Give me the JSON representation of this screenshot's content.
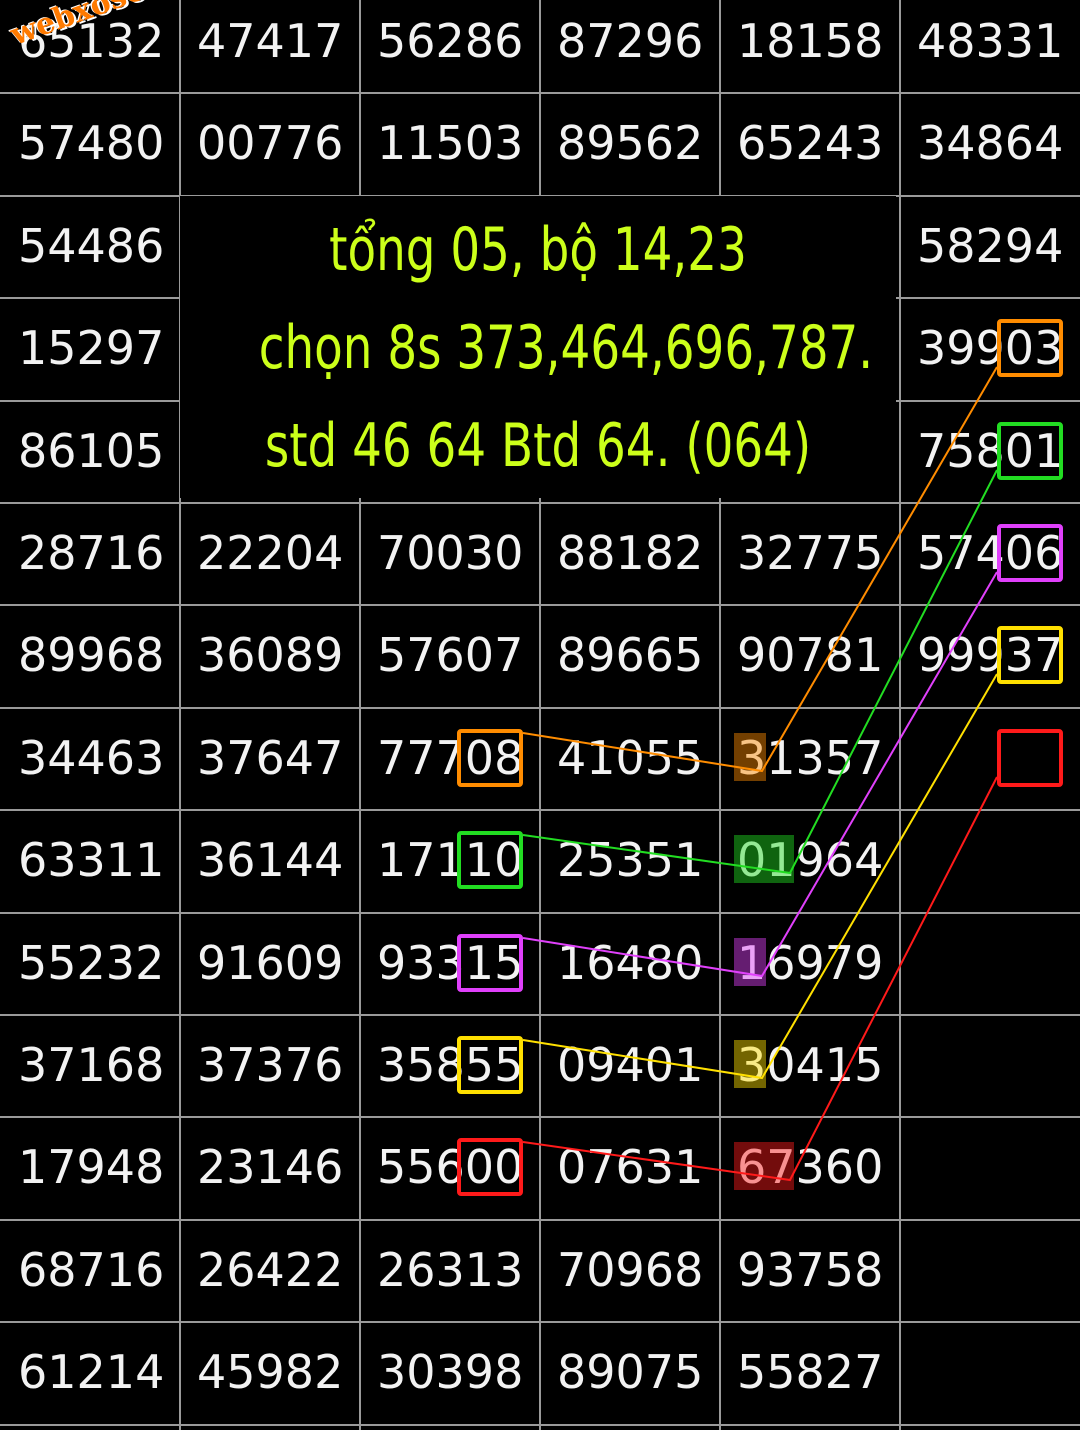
{
  "watermark": "webxoso.net",
  "overlay": {
    "line1": "tổng 05, bộ 14,23",
    "line2": "chọn 8s 373,464,696,787.",
    "line3": "std 46 64 Btd 64. (064)",
    "color": "#ccff1a"
  },
  "rows": [
    [
      "65132",
      "47417",
      "56286",
      "87296",
      "18158",
      "48331"
    ],
    [
      "57480",
      "00776",
      "11503",
      "89562",
      "65243",
      "34864"
    ],
    [
      "54486",
      "",
      "",
      "",
      "",
      "58294"
    ],
    [
      "15297",
      "",
      "",
      "",
      "",
      "39903"
    ],
    [
      "86105",
      "",
      "",
      "",
      "",
      "75801"
    ],
    [
      "28716",
      "22204",
      "70030",
      "88182",
      "32775",
      "57406"
    ],
    [
      "89968",
      "36089",
      "57607",
      "89665",
      "90781",
      "99937"
    ],
    [
      "34463",
      "37647",
      "77708",
      "41055",
      "31357",
      ""
    ],
    [
      "63311",
      "36144",
      "17110",
      "25351",
      "01964",
      ""
    ],
    [
      "55232",
      "91609",
      "93315",
      "16480",
      "16979",
      ""
    ],
    [
      "37168",
      "37376",
      "35855",
      "09401",
      "30415",
      ""
    ],
    [
      "17948",
      "23146",
      "55600",
      "07631",
      "67360",
      ""
    ],
    [
      "68716",
      "26422",
      "26313",
      "70968",
      "93758",
      ""
    ],
    [
      "61214",
      "45982",
      "30398",
      "89075",
      "55827",
      ""
    ]
  ],
  "highlights": [
    {
      "color": "#ff8c00",
      "src": {
        "row": 7,
        "col": 2,
        "digits": 2
      },
      "mid": {
        "row": 7,
        "col": 4,
        "digits": 1
      },
      "dst": {
        "row": 3,
        "col": 5,
        "digits": 2
      }
    },
    {
      "color": "#22dd22",
      "src": {
        "row": 8,
        "col": 2,
        "digits": 2
      },
      "mid": {
        "row": 8,
        "col": 4,
        "digits": 2
      },
      "dst": {
        "row": 4,
        "col": 5,
        "digits": 2
      }
    },
    {
      "color": "#e040fb",
      "src": {
        "row": 9,
        "col": 2,
        "digits": 2
      },
      "mid": {
        "row": 9,
        "col": 4,
        "digits": 1
      },
      "dst": {
        "row": 5,
        "col": 5,
        "digits": 2
      }
    },
    {
      "color": "#ffe000",
      "src": {
        "row": 10,
        "col": 2,
        "digits": 2
      },
      "mid": {
        "row": 10,
        "col": 4,
        "digits": 1
      },
      "dst": {
        "row": 6,
        "col": 5,
        "digits": 2
      }
    },
    {
      "color": "#ff1a1a",
      "src": {
        "row": 11,
        "col": 2,
        "digits": 2
      },
      "mid": {
        "row": 11,
        "col": 4,
        "digits": 2
      },
      "dst": {
        "row": 7,
        "col": 5,
        "digits": 2
      }
    }
  ]
}
